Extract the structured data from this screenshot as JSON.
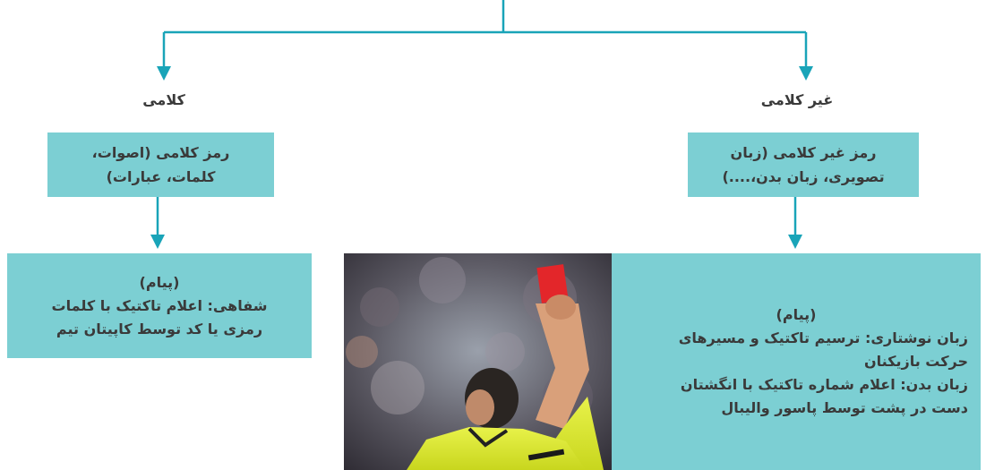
{
  "left_branch": {
    "heading": "کلامی",
    "code_lines": [
      "رمز کلامی (اصوات،",
      "کلمات، عبارات)"
    ],
    "message_title": "(پیام)",
    "message_lines": [
      "شفاهی: اعلام تاکتیک با کلمات",
      "رمزی یا کد توسط کاپیتان تیم"
    ]
  },
  "right_branch": {
    "heading": "غیر کلامی",
    "code_lines": [
      "رمز غیر کلامی (زبان",
      "تصویری، زبان بدن،....)"
    ],
    "message_title": "(پیام)",
    "message_lines": [
      "زبان نوشتاری: ترسیم تاکتیک و مسیرهای",
      "حرکت بازیکنان",
      "زبان بدن: اعلام شماره تاکتیک با انگشتان",
      "دست در پشت توسط پاسور والیبال"
    ]
  },
  "photo": {
    "subject": "referee-showing-red-card"
  },
  "colors": {
    "box": "#7ccfd3",
    "line": "#19a4b8"
  }
}
